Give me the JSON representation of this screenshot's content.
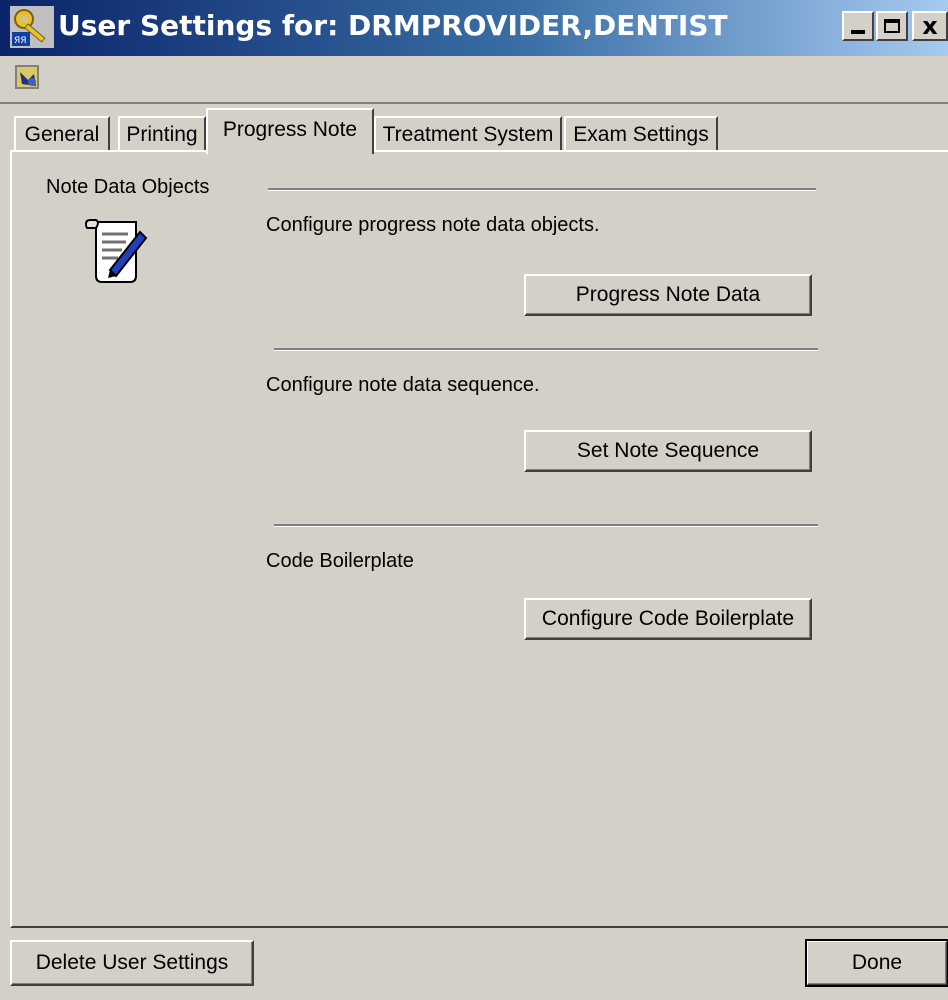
{
  "window": {
    "title": "User Settings for: DRMPROVIDER,DENTIST",
    "controls": {
      "minimize": "_",
      "maximize": "□",
      "close": "×"
    }
  },
  "tabs": [
    {
      "label": "General",
      "active": false
    },
    {
      "label": "Printing",
      "active": false
    },
    {
      "label": "Progress Note",
      "active": true
    },
    {
      "label": "Treatment System",
      "active": false
    },
    {
      "label": "Exam Settings",
      "active": false
    }
  ],
  "panel": {
    "section_label": "Note Data Objects",
    "section_icon": "scroll-note-icon",
    "groups": [
      {
        "description": "Configure progress note data objects.",
        "button": "Progress Note Data"
      },
      {
        "description": "Configure note data sequence.",
        "button": "Set Note Sequence"
      },
      {
        "description": "Code Boilerplate",
        "button": "Configure Code Boilerplate"
      }
    ]
  },
  "footer": {
    "delete_button": "Delete User Settings",
    "done_button": "Done"
  },
  "colors": {
    "title_gradient_start": "#0a246a",
    "title_gradient_end": "#a6caf0",
    "face": "#d4d0c8"
  }
}
